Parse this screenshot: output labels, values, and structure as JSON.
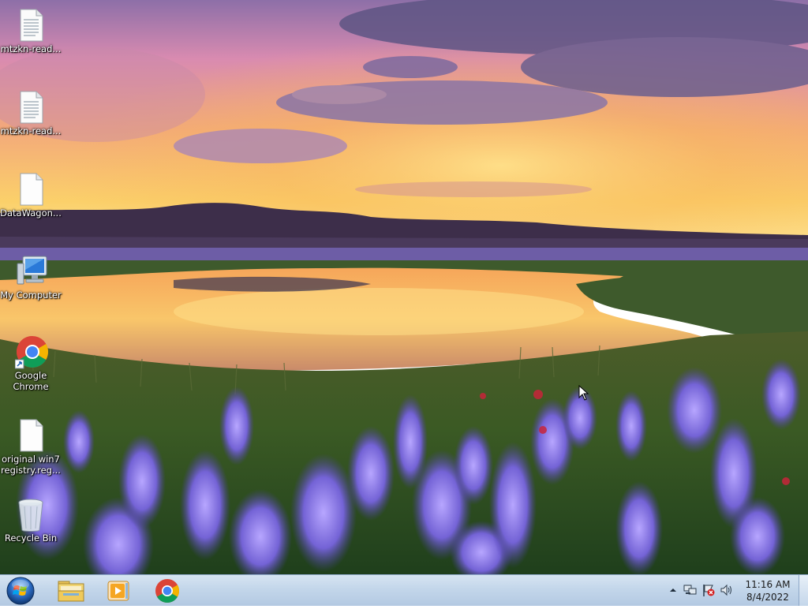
{
  "desktop": {
    "icons": [
      {
        "label": "mtzkn-read...",
        "icon": "text-document-icon"
      },
      {
        "label": "mtzkn-read...",
        "icon": "text-document-icon"
      },
      {
        "label": "DataWagon...",
        "icon": "blank-document-icon"
      },
      {
        "label": "My Computer",
        "icon": "computer-icon"
      },
      {
        "label": "Google\nChrome",
        "icon": "chrome-icon"
      },
      {
        "label": "original win7\nregistry.reg...",
        "icon": "blank-document-icon"
      },
      {
        "label": "Recycle Bin",
        "icon": "recycle-bin-icon"
      }
    ]
  },
  "taskbar": {
    "start": {
      "icon": "windows-logo-icon"
    },
    "pinned": [
      {
        "name": "Windows Explorer",
        "icon": "folder-icon"
      },
      {
        "name": "Windows Media Player",
        "icon": "media-player-icon"
      },
      {
        "name": "Google Chrome",
        "icon": "chrome-icon"
      }
    ],
    "tray": {
      "icons": [
        "show-hidden-icons-arrow",
        "network-icon",
        "action-center-flag-icon",
        "volume-icon"
      ]
    },
    "clock": {
      "time": "11:16 AM",
      "date": "8/4/2022"
    }
  },
  "colors": {
    "taskbar_top": "#d6e4f2",
    "taskbar_bottom": "#b3c9e2",
    "sky_top": "#7a5a9c",
    "sunset": "#f7c04a",
    "flowers": "#7a6ad8"
  }
}
